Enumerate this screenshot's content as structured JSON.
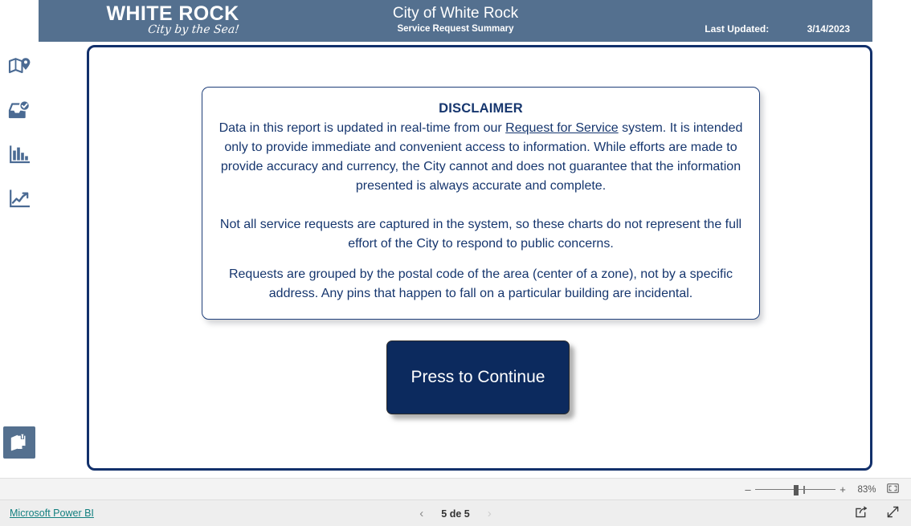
{
  "header": {
    "logo_main": "WHITE ROCK",
    "logo_tagline": "City by the Sea!",
    "title": "City of White Rock",
    "subtitle": "Service Request Summary",
    "updated_label": "Last Updated:",
    "updated_value": "3/14/2023",
    "bar_color": "#54708f"
  },
  "sidebar": {
    "items": [
      {
        "name": "map-pin-icon",
        "label": "Map"
      },
      {
        "name": "inbox-check-icon",
        "label": "Requests"
      },
      {
        "name": "bar-chart-icon",
        "label": "Bar Chart"
      },
      {
        "name": "line-chart-icon",
        "label": "Trend"
      }
    ],
    "bookmark": {
      "name": "bookmark-pin-icon",
      "label": "Bookmarks",
      "active": true
    }
  },
  "disclaimer": {
    "title": "DISCLAIMER",
    "paragraph1_before": "Data in this report is updated in real-time from our ",
    "paragraph1_link": "Request for Service",
    "paragraph1_after": " system. It is intended only to provide immediate and convenient access to information. While efforts are made to provide accuracy and currency, the City cannot and does not guarantee that the information presented is always accurate and complete.",
    "paragraph2": "Not all service requests are captured in the system, so these charts do not represent the full effort of the City to respond to public concerns.",
    "paragraph3": "Requests are grouped by the postal code of the area (center of a zone), not by a specific address. Any pins that happen to fall on a particular building are incidental.",
    "text_color": "#16366e"
  },
  "continue_button": {
    "label": "Press to Continue",
    "background": "#0c2a5e",
    "text_color": "#ffffff"
  },
  "zoom_bar": {
    "minus": "–",
    "plus": "+",
    "percent": "83%",
    "fit_icon": "fit-to-page-icon"
  },
  "footer": {
    "brand_link": "Microsoft Power BI",
    "brand_color": "#127f7f",
    "prev_arrow": "‹",
    "next_arrow": "›",
    "page_label": "5 de 5",
    "share_icon": "share-icon",
    "fullscreen_icon": "fullscreen-icon"
  }
}
